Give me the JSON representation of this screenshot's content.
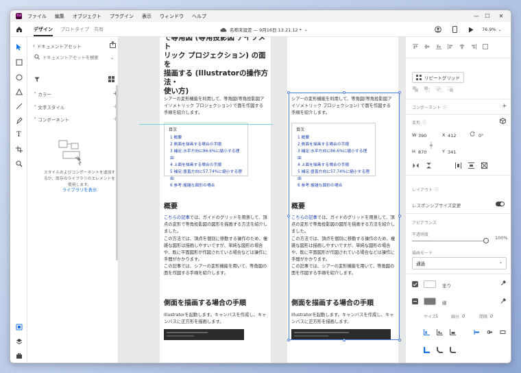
{
  "menu": [
    "ファイル",
    "編集",
    "オブジェクト",
    "プラグイン",
    "表示",
    "ウィンドウ",
    "ヘルプ"
  ],
  "app_icon_text": "Xd",
  "toolbar": {
    "tabs": [
      "デザイン",
      "プロトタイプ",
      "共有"
    ],
    "doc_title": "名称未設定 — 9月16日 13.21.12 *",
    "zoom": "76.9%"
  },
  "left_panel": {
    "header": "ドキュメントアセット",
    "search_placeholder": "ドキュメントアセットを検索",
    "sections": [
      "カラー",
      "文字スタイル",
      "コンポーネント"
    ],
    "empty_text": "スタイルおよびコンポーネントを追加するか、既存のライブラリのエレメントを使用します。",
    "library_link": "ライブラリを表示"
  },
  "artboard": {
    "heading_top": "シアーの変形機能を利用して等角図 (等角投影図 アイソメトリック プロジェクション) の面を描画する (Illustratorの操作方法・使い方)",
    "heading_lines": [
      "で等角図 (等角投影図 アイソメト",
      "リック プロジェクション) の面を",
      "描画する (Illustratorの操作方法・",
      "使い方)"
    ],
    "intro": "シアーの変形機能を利用して、等角図(等角投影図アイソメトリック プロジェクション) で面を作図する手順を紹介します。",
    "toc_title": "目次",
    "toc": [
      "1 概要",
      "2 側面を描画する場合の手順",
      "3 補足:水平方向に86.6%に縮小する理由",
      "4 上面を描画する場合の手順",
      "5 補足:垂直方向に57.74%に縮小する理由",
      "6 参考:複雑な図形の場合"
    ],
    "h_overview": "概要",
    "link_text": "こちらの記事",
    "overview_p1": "では、ガイドのグリッドを用意して、頂点の変形で等角投影図の図形を描画する方法を紹介しました。",
    "overview_p2": "この方法では、頂点を個別に移動する操作のため、複雑な図形は描画しやすいですが、単純な図形の場合や、既に平面図形が作図されている場合などは操作に手間がかかります。",
    "overview_p3": "この記事では、シアーの変形機能を用いて、等角図の面を作図する手順を紹介します。",
    "h_side": "側面を描画する場合の手順",
    "side_p": "Illustratorを起動します。キャンバスを作成し、キャンバスに正方形を描画します。"
  },
  "right_panel": {
    "repeat_grid": "リピートグリッド",
    "component": "コンポーネント",
    "transform": "変形",
    "w_label": "W",
    "w": "390",
    "x_label": "X",
    "x": "412",
    "h_label": "H",
    "h": "870",
    "y_label": "Y",
    "y": "341",
    "rotation": "0°",
    "layout": "レイアウト",
    "responsive": "レスポンシブサイズ変更",
    "appearance": "アピアランス",
    "opacity_label": "不透明度",
    "opacity": "100%",
    "opacity_value": 1.0,
    "blend_label": "描画モード",
    "blend": "通過",
    "fill": "塗り",
    "stroke": "線",
    "size_label": "サイズ",
    "size": "1",
    "dash_label": "線分",
    "dash": "0",
    "gap_label": "間隔",
    "gap": "0"
  }
}
